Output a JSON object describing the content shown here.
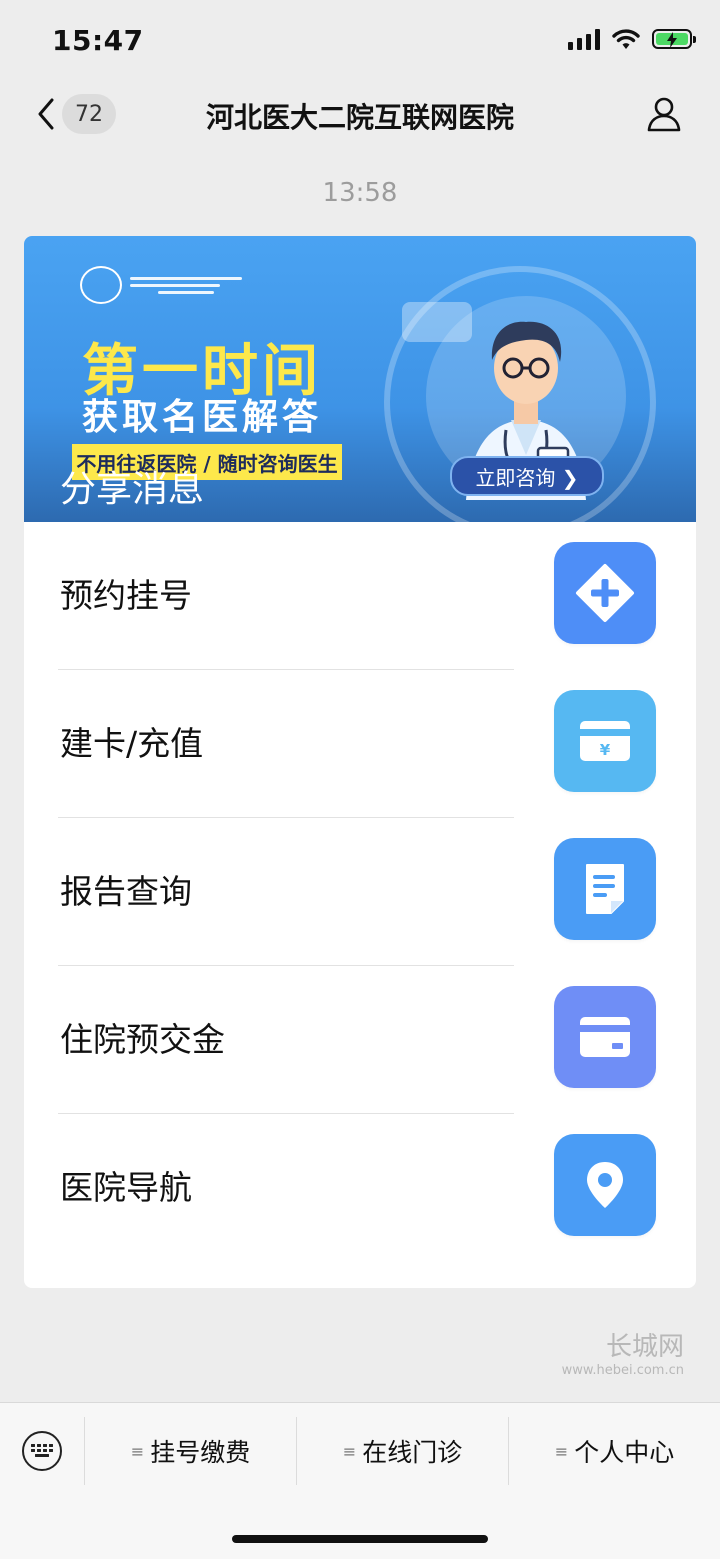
{
  "status": {
    "time": "15:47"
  },
  "nav": {
    "back_count": "72",
    "title": "河北医大二院互联网医院"
  },
  "timestamp": "13:58",
  "banner": {
    "headline1": "第一时间",
    "headline2": "获取名医解答",
    "ribbon": "不用往返医院 / 随时咨询医生",
    "consult_btn": "立即咨询 ❯",
    "share_label": "分享消息"
  },
  "menu": [
    {
      "label": "预约挂号",
      "icon": "plus-diamond-icon",
      "color": "#4e8ef7"
    },
    {
      "label": "建卡/充值",
      "icon": "yen-card-icon",
      "color": "#56b8f2"
    },
    {
      "label": "报告查询",
      "icon": "document-icon",
      "color": "#4a9cf5"
    },
    {
      "label": "住院预交金",
      "icon": "card-icon",
      "color": "#6f8ef6"
    },
    {
      "label": "医院导航",
      "icon": "location-pin-icon",
      "color": "#4a9cf5"
    }
  ],
  "watermark": {
    "line1": "长城网",
    "line2": "www.hebei.com.cn"
  },
  "bottom_tabs": [
    {
      "label": "挂号缴费"
    },
    {
      "label": "在线门诊"
    },
    {
      "label": "个人中心"
    }
  ]
}
